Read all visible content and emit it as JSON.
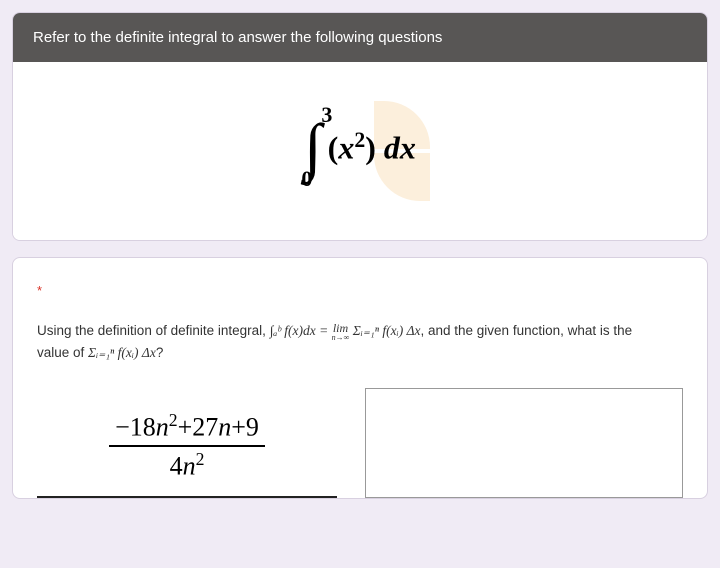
{
  "header": {
    "instruction": "Refer to the definite integral to answer the following questions"
  },
  "integral": {
    "upper": "3",
    "lower": "0",
    "symbol": "∫",
    "body_open": "(",
    "body_var": "x",
    "body_exp": "2",
    "body_close": ") ",
    "dx": "dx"
  },
  "question": {
    "required_mark": "*",
    "prefix": "Using the definition of definite integral, ",
    "math1": "∫ₐᵇ f(x)dx = ",
    "lim": "lim",
    "limsub": "n→∞",
    "math2": " Σᵢ₌₁ⁿ f(xᵢ) Δx",
    "mid": ", and the given function, what is the ",
    "suffix_label": "value of ",
    "math3": "Σᵢ₌₁ⁿ f(xᵢ) Δx",
    "qmark": "?"
  },
  "answer_fraction": {
    "num_lead": "−18",
    "num_var1": "n",
    "num_exp1": "2",
    "num_plus": "+27",
    "num_var2": "n",
    "num_tail": "+9",
    "den_lead": "4",
    "den_var": "n",
    "den_exp": "2"
  }
}
